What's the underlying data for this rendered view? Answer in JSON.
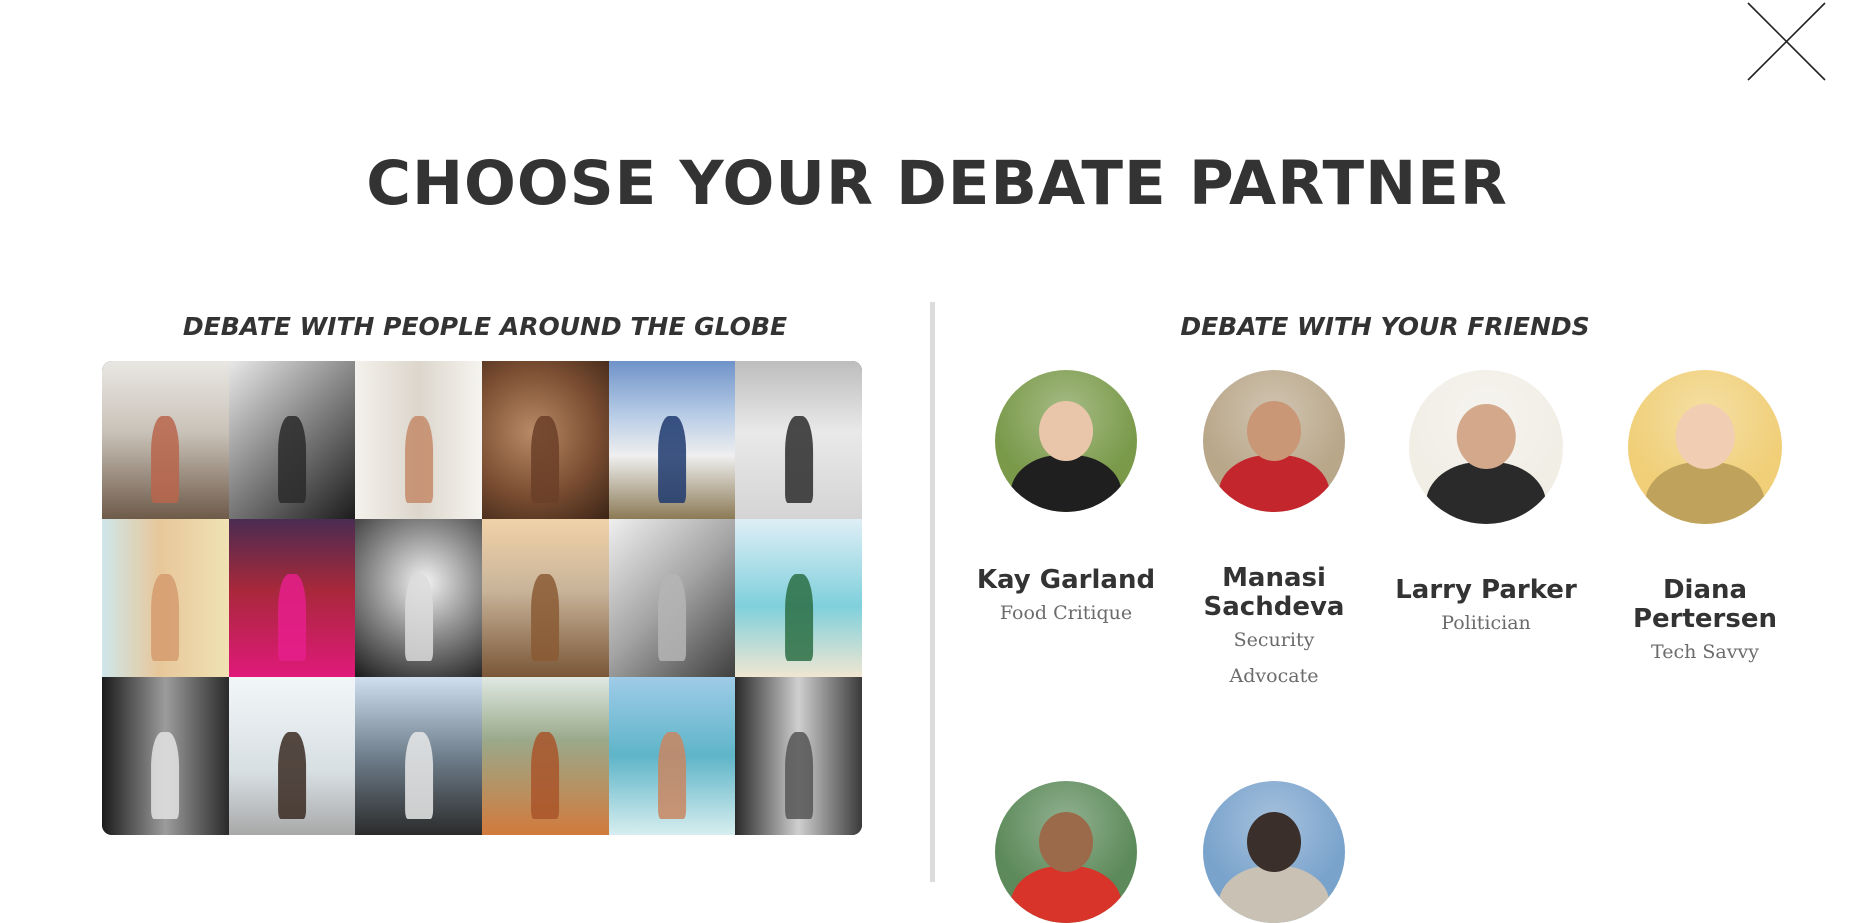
{
  "page": {
    "title": "CHOOSE YOUR DEBATE PARTNER",
    "close_icon": "close-x-icon"
  },
  "globe": {
    "heading": "DEBATE WITH PEOPLE AROUND THE GLOBE",
    "tiles": [
      {
        "bg": "linear-gradient(#e9e7e3 0%, #c9c2b8 45%, #6e5a49 100%)",
        "fig": "#b9654c"
      },
      {
        "bg": "linear-gradient(135deg, #e8e8e8 0%, #8a8a8a 45%, #1c1c1c 100%)",
        "fig": "#2a2a2a"
      },
      {
        "bg": "linear-gradient(90deg, #f4f1ec 0%, #dcd6cc 50%, #f6f4f0 100%)",
        "fig": "#c48a68"
      },
      {
        "bg": "radial-gradient(circle at 40% 45%, #b98a66 0%, #7b4e32 55%, #3b2416 100%)",
        "fig": "#6a3f28"
      },
      {
        "bg": "linear-gradient(#6f93c9 0%, #b9cde6 35%, #efefef 60%, #8b7a55 100%)",
        "fig": "#1f3a6e"
      },
      {
        "bg": "linear-gradient(#bdbdbd 0%, #e9e9e9 45%, #d4d4d4 100%)",
        "fig": "#2b2b2b"
      },
      {
        "bg": "linear-gradient(90deg, #cfe6ea 0%, #e7c79a 45%, #f0e2b4 100%)",
        "fig": "#d59b6e"
      },
      {
        "bg": "linear-gradient(#4a2c52 0%, #a8283a 45%, #e0197a 100%)",
        "fig": "#e61f8c"
      },
      {
        "bg": "radial-gradient(circle at 55% 40%, #f2f2f2 0%, #8f8f8f 45%, #1a1a1a 100%)",
        "fig": "#dcdcdc"
      },
      {
        "bg": "linear-gradient(#f1d2a8 0%, #c9b49a 45%, #7a5637 100%)",
        "fig": "#8a5a34"
      },
      {
        "bg": "linear-gradient(135deg, #efefef 0%, #a3a3a3 50%, #3f3f3f 100%)",
        "fig": "#b5b5b5"
      },
      {
        "bg": "linear-gradient(#dfeef6 0%, #7fd0dc 55%, #f0e6d2 100%)",
        "fig": "#2c6e44"
      },
      {
        "bg": "linear-gradient(90deg, #1b1b1b 0%, #9c9c9c 50%, #2a2a2a 100%)",
        "fig": "#e3e3e3"
      },
      {
        "bg": "linear-gradient(#f2f6f8 0%, #d7dfe3 60%, #a8a8a8 100%)",
        "fig": "#3a2a22"
      },
      {
        "bg": "linear-gradient(#cfdff0 0%, #6f7f8c 50%, #2b2b2b 100%)",
        "fig": "#e8e8e8"
      },
      {
        "bg": "linear-gradient(#dfe9e2 0%, #9aa98a 40%, #d27a3c 100%)",
        "fig": "#a9552a"
      },
      {
        "bg": "linear-gradient(#9ecbe8 0%, #5fb5c8 50%, #d7eef0 100%)",
        "fig": "#c98662"
      },
      {
        "bg": "linear-gradient(90deg, #2a2a2a 0%, #cfcfcf 50%, #3a3a3a 100%)",
        "fig": "#555555"
      }
    ]
  },
  "friends": {
    "heading": "DEBATE WITH YOUR FRIENDS",
    "people": [
      {
        "name": "Kay Garland",
        "role": "Food Critique",
        "icon": "avatar-kay-garland",
        "bg": "#7a9a4a",
        "head": "#e9c6aa",
        "body": "#1f1f1f"
      },
      {
        "name": "Manasi Sachdeva",
        "role": "Security Advocate",
        "icon": "avatar-manasi-sachdeva",
        "bg": "#b9a78a",
        "head": "#c99676",
        "body": "#c4262e"
      },
      {
        "name": "Larry Parker",
        "role": "Politician",
        "icon": "avatar-larry-parker",
        "bg": "#f1eee6",
        "head": "#d4a88a",
        "body": "#2a2a2a"
      },
      {
        "name": "Diana Pertersen",
        "role": "Tech Savvy",
        "icon": "avatar-diana-pertersen",
        "bg": "#f0cf78",
        "head": "#f0cdb3",
        "body": "#bfa35c"
      },
      {
        "name": "",
        "role": "",
        "icon": "avatar-friend-5",
        "bg": "#5c8a5a",
        "head": "#9b6a4a",
        "body": "#d8342a"
      },
      {
        "name": "",
        "role": "",
        "icon": "avatar-friend-6",
        "bg": "#7aa3cc",
        "head": "#3a2f2a",
        "body": "#c9c2b4"
      }
    ]
  }
}
